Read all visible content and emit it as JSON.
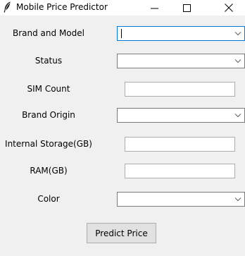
{
  "window": {
    "title": "Mobile Price Predictor",
    "minimize_icon": "minimize-icon",
    "maximize_icon": "maximize-icon",
    "close_icon": "close-icon",
    "app_icon": "feather-icon"
  },
  "form": {
    "brand_model_label": "Brand and Model",
    "status_label": "Status",
    "sim_count_label": "SIM Count",
    "brand_origin_label": "Brand Origin",
    "internal_storage_label": "Internal Storage(GB)",
    "ram_label": "RAM(GB)",
    "color_label": "Color",
    "brand_model_value": "",
    "status_value": "",
    "sim_count_value": "",
    "brand_origin_value": "",
    "internal_storage_value": "",
    "ram_value": "",
    "color_value": ""
  },
  "actions": {
    "predict_label": "Predict Price"
  },
  "colors": {
    "window_bg": "#f0f0f0",
    "focus_border": "#0078d7",
    "field_border": "#7a7a7a",
    "button_bg": "#e1e1e1"
  }
}
